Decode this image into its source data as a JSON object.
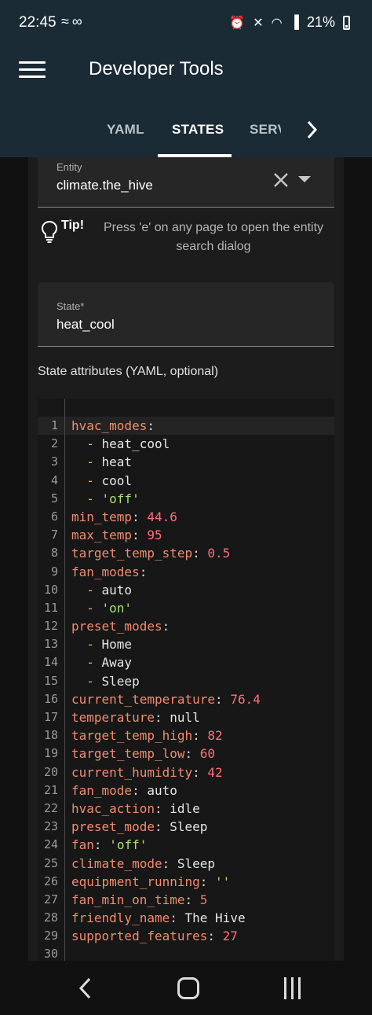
{
  "status_bar": {
    "time": "22:45",
    "battery": "21%"
  },
  "app_bar": {
    "title": "Developer Tools",
    "tabs": [
      {
        "label": "YAML"
      },
      {
        "label": "STATES",
        "active": true
      },
      {
        "label": "SERVICES"
      }
    ]
  },
  "entity_field": {
    "label": "Entity",
    "value": "climate.the_hive"
  },
  "tip": {
    "label": "Tip!",
    "text": "Press 'e' on any page to open the entity search dialog"
  },
  "state_field": {
    "label": "State*",
    "value": "heat_cool"
  },
  "attributes": {
    "label": "State attributes (YAML, optional)",
    "lines": [
      {
        "n": "1",
        "key": "hvac_modes",
        "type": "key"
      },
      {
        "n": "2",
        "item": "heat_cool",
        "vtype": "v"
      },
      {
        "n": "3",
        "item": "heat",
        "vtype": "v"
      },
      {
        "n": "4",
        "item": "cool",
        "vtype": "v"
      },
      {
        "n": "5",
        "item": "'off'",
        "vtype": "s"
      },
      {
        "n": "6",
        "key": "min_temp",
        "value": "44.6",
        "vtype": "n"
      },
      {
        "n": "7",
        "key": "max_temp",
        "value": "95",
        "vtype": "n"
      },
      {
        "n": "8",
        "key": "target_temp_step",
        "value": "0.5",
        "vtype": "n"
      },
      {
        "n": "9",
        "key": "fan_modes",
        "type": "key"
      },
      {
        "n": "10",
        "item": "auto",
        "vtype": "v"
      },
      {
        "n": "11",
        "item": "'on'",
        "vtype": "s"
      },
      {
        "n": "12",
        "key": "preset_modes",
        "type": "key"
      },
      {
        "n": "13",
        "item": "Home",
        "vtype": "v"
      },
      {
        "n": "14",
        "item": "Away",
        "vtype": "v"
      },
      {
        "n": "15",
        "item": "Sleep",
        "vtype": "v"
      },
      {
        "n": "16",
        "key": "current_temperature",
        "value": "76.4",
        "vtype": "n"
      },
      {
        "n": "17",
        "key": "temperature",
        "value": "null",
        "vtype": "v"
      },
      {
        "n": "18",
        "key": "target_temp_high",
        "value": "82",
        "vtype": "n"
      },
      {
        "n": "19",
        "key": "target_temp_low",
        "value": "60",
        "vtype": "n"
      },
      {
        "n": "20",
        "key": "current_humidity",
        "value": "42",
        "vtype": "n"
      },
      {
        "n": "21",
        "key": "fan_mode",
        "value": "auto",
        "vtype": "v"
      },
      {
        "n": "22",
        "key": "hvac_action",
        "value": "idle",
        "vtype": "v"
      },
      {
        "n": "23",
        "key": "preset_mode",
        "value": "Sleep",
        "vtype": "v"
      },
      {
        "n": "24",
        "key": "fan",
        "value": "'off'",
        "vtype": "s"
      },
      {
        "n": "25",
        "key": "climate_mode",
        "value": "Sleep",
        "vtype": "v"
      },
      {
        "n": "26",
        "key": "equipment_running",
        "value": "''",
        "vtype": "s"
      },
      {
        "n": "27",
        "key": "fan_min_on_time",
        "value": "5",
        "vtype": "n"
      },
      {
        "n": "28",
        "key": "friendly_name",
        "value": "The Hive",
        "vtype": "v"
      },
      {
        "n": "29",
        "key": "supported_features",
        "value": "27",
        "vtype": "n"
      },
      {
        "n": "30"
      }
    ]
  }
}
